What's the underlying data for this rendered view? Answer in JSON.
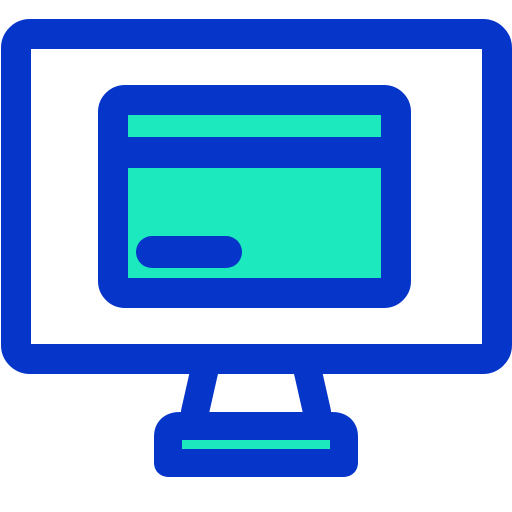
{
  "icon": {
    "name": "computer-monitor-with-card-icon",
    "colors": {
      "stroke": "#0635c9",
      "fill": "#1de9be",
      "background": "#ffffff"
    }
  }
}
